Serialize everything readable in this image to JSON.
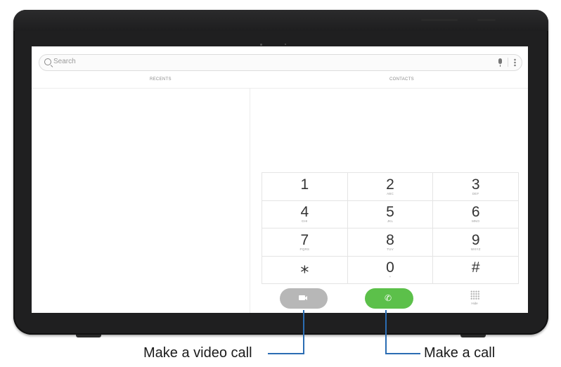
{
  "search": {
    "placeholder": "Search"
  },
  "tabs": {
    "recents": "RECENTS",
    "contacts": "CONTACTS"
  },
  "keypad": [
    {
      "digit": "1",
      "letters": ""
    },
    {
      "digit": "2",
      "letters": "ABC"
    },
    {
      "digit": "3",
      "letters": "DEF"
    },
    {
      "digit": "4",
      "letters": "GHI"
    },
    {
      "digit": "5",
      "letters": "JKL"
    },
    {
      "digit": "6",
      "letters": "MNO"
    },
    {
      "digit": "7",
      "letters": "PQRS"
    },
    {
      "digit": "8",
      "letters": "TUV"
    },
    {
      "digit": "9",
      "letters": "WXYZ"
    },
    {
      "digit": "⁎",
      "letters": ""
    },
    {
      "digit": "0",
      "letters": "+"
    },
    {
      "digit": "#",
      "letters": ""
    }
  ],
  "actions": {
    "hide_label": "Hide"
  },
  "callouts": {
    "video_call": "Make a video call",
    "call": "Make a call"
  },
  "colors": {
    "call_green": "#5cc04a",
    "video_gray": "#b7b7b7",
    "leader_blue": "#2b6db3"
  },
  "icons": {
    "video": "video-camera-icon",
    "call": "phone-icon",
    "hide": "dialpad-dots-icon"
  }
}
